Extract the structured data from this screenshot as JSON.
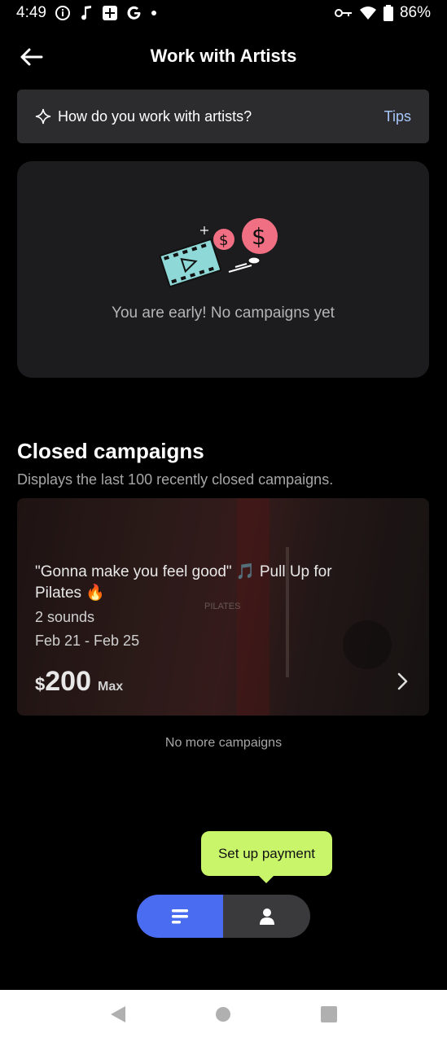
{
  "status_bar": {
    "time": "4:49",
    "battery": "86%"
  },
  "header": {
    "title": "Work with Artists"
  },
  "tips": {
    "prompt": "How do you work with artists?",
    "link": "Tips"
  },
  "empty_state": {
    "message": "You are early! No campaigns yet"
  },
  "closed": {
    "title": "Closed campaigns",
    "subtitle": "Displays the last 100 recently closed campaigns."
  },
  "campaign": {
    "title": "\"Gonna make you feel good\" 🎵 Pull Up for Pilates 🔥",
    "sounds": "2 sounds",
    "dates": "Feb 21 - Feb 25",
    "price_currency": "$",
    "price_value": "200",
    "price_suffix": "Max",
    "watermark": "PILATES"
  },
  "footer": {
    "no_more": "No more campaigns"
  },
  "tooltip": {
    "label": "Set up payment"
  },
  "colors": {
    "accent": "#4a6cf0",
    "tooltip_bg": "#c8f56a",
    "tips_link": "#a8c7fa"
  }
}
